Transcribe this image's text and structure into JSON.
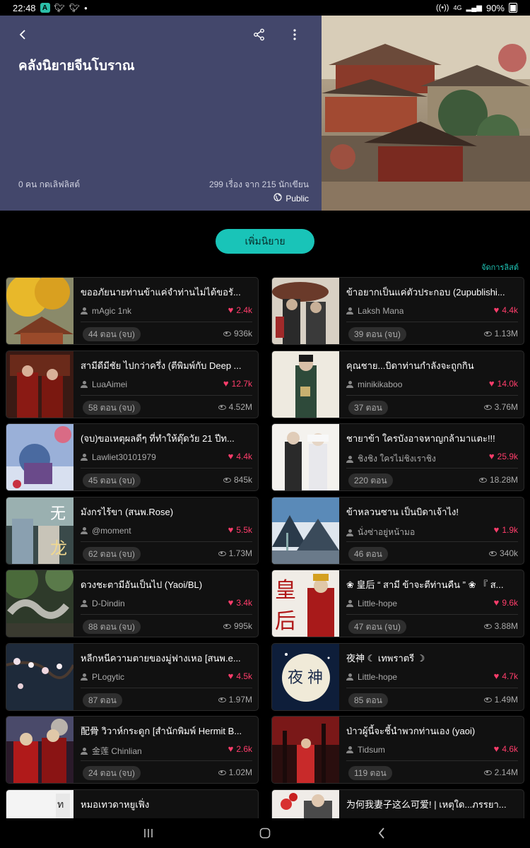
{
  "status_bar": {
    "time": "22:48",
    "app_badge": "A",
    "battery": "90%",
    "network": "4G"
  },
  "header": {
    "title": "คลังนิยายจีนโบราณ",
    "likes": "0 คน กดเลิฟลิสต์",
    "count": "299 เรื่อง จาก 215 นักเขียน",
    "visibility": "Public",
    "bg_color": "#43476b"
  },
  "actions": {
    "add_label": "เพิ่มนิยาย",
    "manage_label": "จัดการลิสต์"
  },
  "stories": [
    {
      "title": "ขออภัยนายท่านข้าแค่จำท่านไม่ได้ขอรั...",
      "author": "mAgic 1nk",
      "likes": "2.4k",
      "episodes": "44 ตอน (จบ)",
      "views": "936k",
      "thumb": "autumn-palace"
    },
    {
      "title": "ข้าอยากเป็นแค่ตัวประกอบ (2upublishi...",
      "author": "Laksh Mana",
      "likes": "4.4k",
      "episodes": "39 ตอน (จบ)",
      "views": "1.13M",
      "thumb": "umbrella-warriors"
    },
    {
      "title": "สามีดีมีชัย ไปกว่าครึ่ง (ตีพิมพ์กับ Deep ...",
      "author": "LuaAimei",
      "likes": "12.7k",
      "episodes": "58 ตอน (จบ)",
      "views": "4.52M",
      "thumb": "red-robes"
    },
    {
      "title": "คุณชาย...บิดาท่านกำลังจะถูกกิน",
      "author": "minikikaboo",
      "likes": "14.0k",
      "episodes": "37 ตอน",
      "views": "3.76M",
      "thumb": "green-scholar"
    },
    {
      "title": "(จบ)ขอเหตุผลดีๆ ที่ทำให้ตุ๊ดวัย 21 ปีท...",
      "author": "Lawliet30101979",
      "likes": "4.4k",
      "episodes": "45 ตอน (จบ)",
      "views": "845k",
      "thumb": "blue-snow"
    },
    {
      "title": "ชายาข้า ใครบังอาจหาญกล้ามาแตะ!!!",
      "author": "ชิงชิง ใครไม่ชิงเราชิง",
      "likes": "25.9k",
      "episodes": "220 ตอน",
      "views": "18.28M",
      "thumb": "sketch-pair"
    },
    {
      "title": "มังกรไร้ขา (สนพ.Rose)",
      "author": "@moment",
      "likes": "5.5k",
      "episodes": "62 ตอน (จบ)",
      "views": "1.73M",
      "thumb": "dragon-cover"
    },
    {
      "title": "ข้าหลวนซาน เป็นบิดาเจ้าไง!",
      "author": "นั่งซ่าอยู่หน้ามอ",
      "likes": "1.9k",
      "episodes": "46 ตอน",
      "views": "340k",
      "thumb": "mountain-mist"
    },
    {
      "title": "ดวงชะตามีอันเป็นไป (Yaoi/BL)",
      "author": "D-Dindin",
      "likes": "3.4k",
      "episodes": "88 ตอน (จบ)",
      "views": "995k",
      "thumb": "stone-dragon"
    },
    {
      "title": "❀ 皇后 “ สามี ข้าจะตีท่านคืน ” ❀ 『 ส...",
      "author": "Little-hope",
      "likes": "9.6k",
      "episodes": "47 ตอน (จบ)",
      "views": "3.88M",
      "thumb": "empress"
    },
    {
      "title": "หลีกหนีความตายของมู่ฟางเหอ [สนพ.e...",
      "author": "PLogytic",
      "likes": "4.5k",
      "episodes": "87 ตอน",
      "views": "1.97M",
      "thumb": "plum-blossom"
    },
    {
      "title": "夜神 ☾ เทพราตรี ☽",
      "author": "Little-hope",
      "likes": "4.7k",
      "episodes": "85 ตอน",
      "views": "1.49M",
      "thumb": "night-god"
    },
    {
      "title": "配骨 วิวาห์กระดูก [สำนักพิมพ์ Hermit B...",
      "author": "金莲 Chinlian",
      "likes": "2.6k",
      "episodes": "24 ตอน (จบ)",
      "views": "1.02M",
      "thumb": "wedding"
    },
    {
      "title": "ป่าวผู้นี้จะชี้นำพวกท่านเอง (yaoi)",
      "author": "Tidsum",
      "likes": "4.6k",
      "episodes": "119 ตอน",
      "views": "2.14M",
      "thumb": "red-forest"
    },
    {
      "title": "หมอเทวดาหยูเฟิ่ง",
      "author": "",
      "likes": "",
      "episodes": "",
      "views": "",
      "thumb": "white-scroll"
    },
    {
      "title": "为何我妻子这么可爱! | เหตุใด...ภรรยา...",
      "author": "",
      "likes": "",
      "episodes": "",
      "views": "",
      "thumb": "red-white"
    }
  ]
}
